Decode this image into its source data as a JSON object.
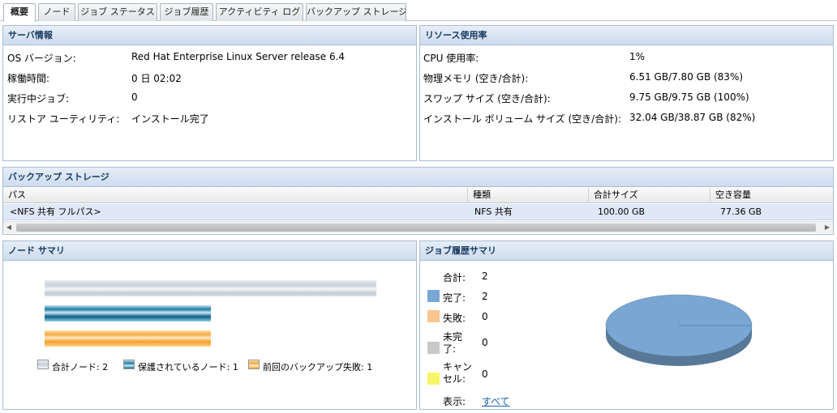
{
  "tabs": [
    {
      "label": "概要"
    },
    {
      "label": "ノード"
    },
    {
      "label": "ジョブ ステータス"
    },
    {
      "label": "ジョブ履歴"
    },
    {
      "label": "アクティビティ ログ"
    },
    {
      "label": "バックアップ ストレージ"
    }
  ],
  "server_info": {
    "title": "サーバ情報",
    "rows": [
      {
        "key": "OS バージョン:",
        "value": "Red Hat Enterprise Linux Server release 6.4"
      },
      {
        "key": "稼働時間:",
        "value": "0 日 02:02"
      },
      {
        "key": "実行中ジョブ:",
        "value": "0"
      },
      {
        "key": "リストア ユーティリティ:",
        "value": "インストール完了"
      }
    ]
  },
  "resource_usage": {
    "title": "リソース使用率",
    "rows": [
      {
        "key": "CPU 使用率:",
        "value": "1%"
      },
      {
        "key": "物理メモリ (空き/合計):",
        "value": "6.51 GB/7.80 GB (83%)"
      },
      {
        "key": "スワップ サイズ (空き/合計):",
        "value": "9.75 GB/9.75 GB (100%)"
      },
      {
        "key": "インストール ボリューム サイズ (空き/合計):",
        "value": "32.04 GB/38.87 GB (82%)"
      }
    ]
  },
  "backup_storage": {
    "title": "バックアップ ストレージ",
    "columns": [
      "パス",
      "種類",
      "合計サイズ",
      "空き容量"
    ],
    "rows": [
      [
        "<NFS 共有 フルパス>",
        "NFS 共有",
        "100.00 GB",
        "77.36 GB"
      ]
    ]
  },
  "node_summary": {
    "title": "ノード サマリ",
    "legend": [
      {
        "label": "合計ノード: 2"
      },
      {
        "label": "保護されているノード: 1"
      },
      {
        "label": "前回のバックアップ失敗: 1"
      }
    ],
    "chart_data": {
      "type": "bar",
      "categories": [
        "合計ノード",
        "保護されているノード",
        "前回のバックアップ失敗"
      ],
      "values": [
        2,
        1,
        1
      ],
      "colors": [
        "#c7d2da",
        "#1e79a6",
        "#f6a93c"
      ],
      "xlim": [
        0,
        2
      ]
    }
  },
  "job_history": {
    "title": "ジョブ履歴サマリ",
    "total_label": "合計:",
    "total_value": "2",
    "items": [
      {
        "label": "完了:",
        "value": "2",
        "color": "#7aa6d3"
      },
      {
        "label": "失敗:",
        "value": "0",
        "color": "#f9c58d"
      },
      {
        "label": "未完了:",
        "value": "0",
        "color": "#c9c9c9"
      },
      {
        "label": "キャンセル:",
        "value": "0",
        "color": "#f7f56a"
      }
    ],
    "display_label": "表示:",
    "display_link": "すべて",
    "chart_data": {
      "type": "pie",
      "categories": [
        "完了",
        "失敗",
        "未完了",
        "キャンセル"
      ],
      "values": [
        2,
        0,
        0,
        0
      ],
      "colors": [
        "#7aa6d3",
        "#f9c58d",
        "#c9c9c9",
        "#f7f56a"
      ]
    }
  }
}
